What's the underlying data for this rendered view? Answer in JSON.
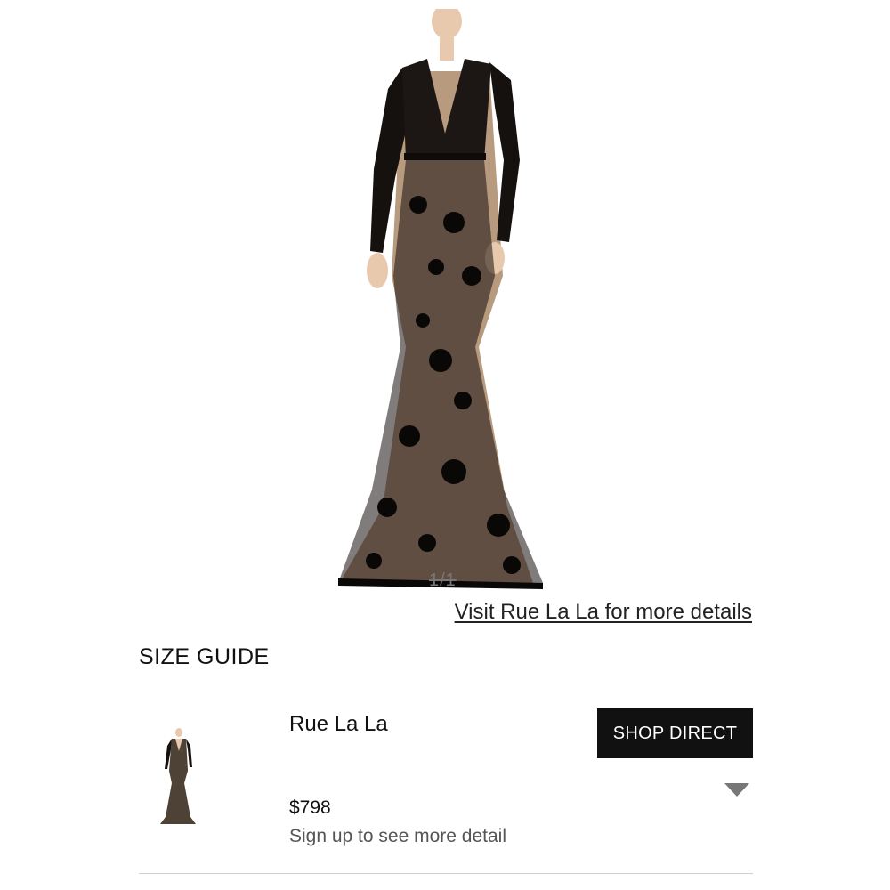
{
  "gallery": {
    "image_alt": "Black lace long sleeve gown",
    "counter": "1/1",
    "visit_link": "Visit Rue La La for more details"
  },
  "size_guide": {
    "label": "SIZE GUIDE"
  },
  "offer": {
    "retailer": "Rue La La",
    "price": "$798",
    "note": "Sign up to see more detail",
    "shop_button": "SHOP DIRECT",
    "expand_icon": "triangle-down-icon"
  },
  "colors": {
    "button_bg": "#111111",
    "button_text": "#ffffff",
    "dress": "#15110f",
    "lining": "#b89a7e",
    "skin": "#e8c9ae",
    "expand_icon": "#777777",
    "divider": "#cfcfcf"
  }
}
